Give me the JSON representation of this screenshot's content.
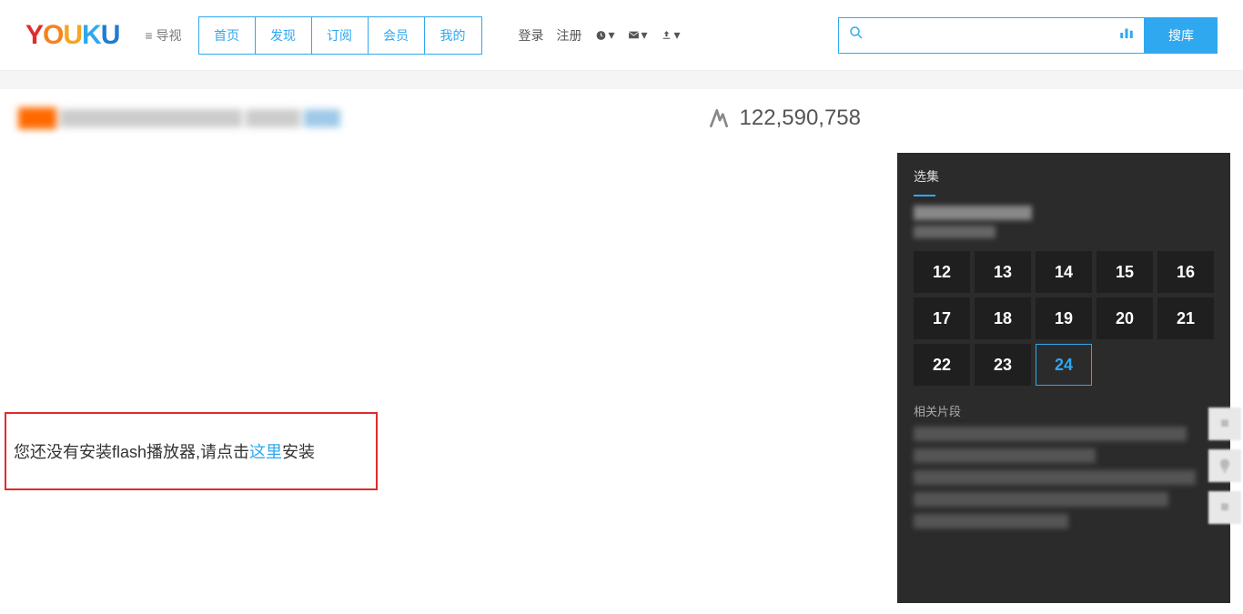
{
  "header": {
    "nav_toggle": "导视",
    "tabs": [
      "首页",
      "发现",
      "订阅",
      "会员",
      "我的"
    ],
    "login": "登录",
    "register": "注册",
    "search_placeholder": "",
    "search_btn": "搜库"
  },
  "play_count": "122,590,758",
  "flash": {
    "prefix": "您还没有安装flash播放器,请点击",
    "link": "这里",
    "suffix": "安装"
  },
  "episodes": {
    "title": "选集",
    "items": [
      12,
      13,
      14,
      15,
      16,
      17,
      18,
      19,
      20,
      21,
      22,
      23,
      24
    ],
    "active": 24,
    "related_title": "相关片段"
  }
}
